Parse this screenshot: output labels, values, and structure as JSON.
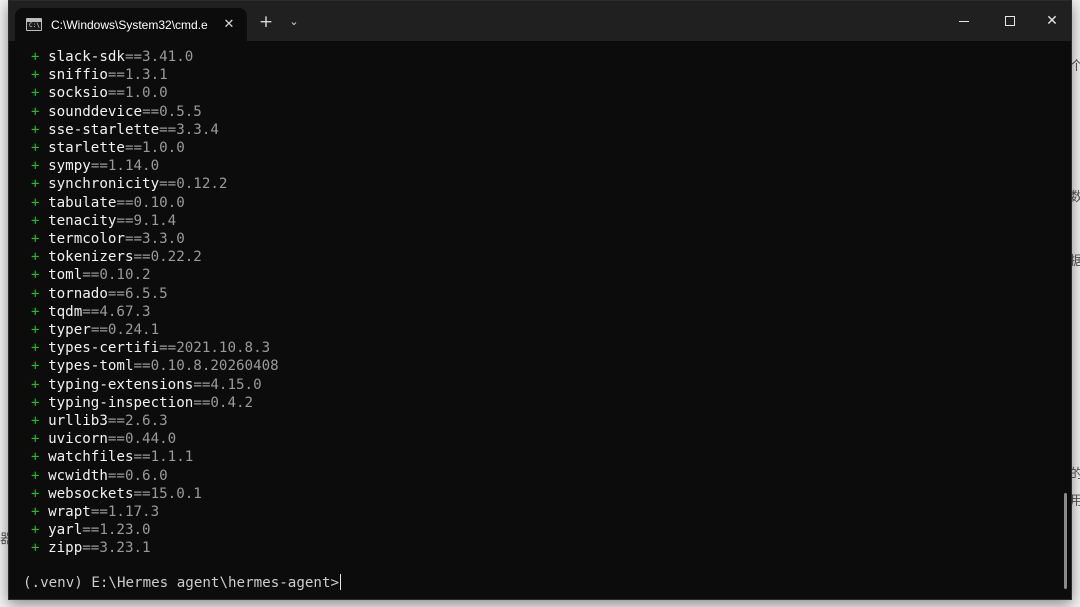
{
  "window": {
    "tab_title": "C:\\Windows\\System32\\cmd.e",
    "tab_icon_text": "C:\\",
    "tab_close": "✕",
    "new_tab": "+",
    "dropdown": "⌄",
    "close_glyph": "✕"
  },
  "terminal": {
    "plus": "+",
    "packages": [
      {
        "name": "slack-sdk",
        "version": "==3.41.0"
      },
      {
        "name": "sniffio",
        "version": "==1.3.1"
      },
      {
        "name": "socksio",
        "version": "==1.0.0"
      },
      {
        "name": "sounddevice",
        "version": "==0.5.5"
      },
      {
        "name": "sse-starlette",
        "version": "==3.3.4"
      },
      {
        "name": "starlette",
        "version": "==1.0.0"
      },
      {
        "name": "sympy",
        "version": "==1.14.0"
      },
      {
        "name": "synchronicity",
        "version": "==0.12.2"
      },
      {
        "name": "tabulate",
        "version": "==0.10.0"
      },
      {
        "name": "tenacity",
        "version": "==9.1.4"
      },
      {
        "name": "termcolor",
        "version": "==3.3.0"
      },
      {
        "name": "tokenizers",
        "version": "==0.22.2"
      },
      {
        "name": "toml",
        "version": "==0.10.2"
      },
      {
        "name": "tornado",
        "version": "==6.5.5"
      },
      {
        "name": "tqdm",
        "version": "==4.67.3"
      },
      {
        "name": "typer",
        "version": "==0.24.1"
      },
      {
        "name": "types-certifi",
        "version": "==2021.10.8.3"
      },
      {
        "name": "types-toml",
        "version": "==0.10.8.20260408"
      },
      {
        "name": "typing-extensions",
        "version": "==4.15.0"
      },
      {
        "name": "typing-inspection",
        "version": "==0.4.2"
      },
      {
        "name": "urllib3",
        "version": "==2.6.3"
      },
      {
        "name": "uvicorn",
        "version": "==0.44.0"
      },
      {
        "name": "watchfiles",
        "version": "==1.1.1"
      },
      {
        "name": "wcwidth",
        "version": "==0.6.0"
      },
      {
        "name": "websockets",
        "version": "==15.0.1"
      },
      {
        "name": "wrapt",
        "version": "==1.17.3"
      },
      {
        "name": "yarl",
        "version": "==1.23.0"
      },
      {
        "name": "zipp",
        "version": "==3.23.1"
      }
    ],
    "prompt": "(.venv) E:\\Hermes agent\\hermes-agent>"
  },
  "colors": {
    "plus": "#16c60c",
    "background": "#0c0c0c",
    "titlebar": "#202020"
  },
  "background_app": {
    "glyphs": [
      "个",
      "数",
      "据",
      "的",
      "用",
      "器"
    ]
  }
}
